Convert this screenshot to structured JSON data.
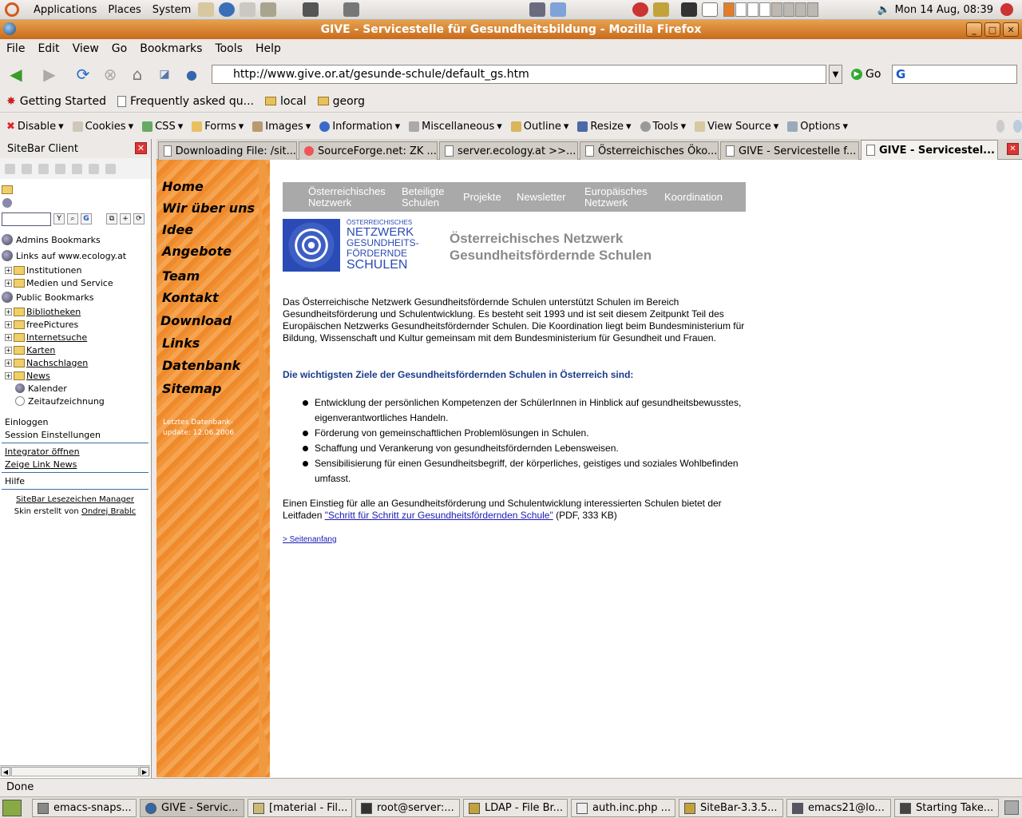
{
  "panel": {
    "menus": [
      "Applications",
      "Places",
      "System"
    ],
    "clock": "Mon 14 Aug, 08:39"
  },
  "window": {
    "title": "GIVE - Servicestelle für Gesundheitsbildung - Mozilla Firefox",
    "menu": [
      "File",
      "Edit",
      "View",
      "Go",
      "Bookmarks",
      "Tools",
      "Help"
    ]
  },
  "nav": {
    "url": "http://www.give.or.at/gesunde-schule/default_gs.htm",
    "go_label": "Go"
  },
  "bookmarks_bar": [
    "Getting Started",
    "Frequently asked qu...",
    "local",
    "georg"
  ],
  "devtoolbar": [
    "Disable",
    "Cookies",
    "CSS",
    "Forms",
    "Images",
    "Information",
    "Miscellaneous",
    "Outline",
    "Resize",
    "Tools",
    "View Source",
    "Options"
  ],
  "sidebar": {
    "title": "SiteBar Client",
    "tree": {
      "admins": "Admins Bookmarks",
      "links_root": "Links auf www.ecology.at",
      "links_children": [
        "Institutionen",
        "Medien und Service"
      ],
      "public_root": "Public Bookmarks",
      "public_children": [
        "Bibliotheken",
        "freePictures",
        "Internetsuche",
        "Karten",
        "Nachschlagen",
        "News"
      ],
      "kalender": "Kalender",
      "zeit": "Zeitaufzeichnung"
    },
    "links": {
      "login": "Einloggen",
      "session": "Session Einstellungen",
      "integrator": "Integrator öffnen",
      "link_news": "Zeige Link News",
      "help": "Hilfe"
    },
    "credit": {
      "manager": "SiteBar Lesezeichen Manager",
      "skin_prefix": "Skin erstellt von",
      "author": "Ondrej Brablc"
    }
  },
  "tabs": [
    {
      "label": "Downloading File: /sit..."
    },
    {
      "label": "SourceForge.net: ZK ..."
    },
    {
      "label": "server.ecology.at >>..."
    },
    {
      "label": "Österreichisches Öko..."
    },
    {
      "label": "GIVE - Servicestelle f..."
    },
    {
      "label": "GIVE - Servicestel..."
    }
  ],
  "page": {
    "leftnav": [
      "Home",
      "Wir über uns",
      "Idee",
      "Angebote",
      "Team",
      "Kontakt",
      "Download",
      "Links",
      "Datenbank",
      "Sitemap"
    ],
    "update_line1": "Letztes Datenbank-",
    "update_line2": "update: 12.06.2006",
    "topnav": [
      {
        "l1": "Österreichisches",
        "l2": "Netzwerk"
      },
      {
        "l1": "Beteiligte",
        "l2": "Schulen"
      },
      {
        "l1": "Projekte",
        "l2": ""
      },
      {
        "l1": "Newsletter",
        "l2": ""
      },
      {
        "l1": "Europäisches",
        "l2": "Netzwerk"
      },
      {
        "l1": "Koordination",
        "l2": ""
      }
    ],
    "logo": {
      "line1": "ÖSTERREICHISCHES",
      "line2": "NETZWERK",
      "line3": "GESUNDHEITS-",
      "line4": "FÖRDERNDE",
      "line5": "SCHULEN"
    },
    "heading1": "Österreichisches Netzwerk",
    "heading2": "Gesundheitsfördernde Schulen",
    "intro": "Das Österreichische Netzwerk Gesundheitsfördernde Schulen unterstützt Schulen im Bereich Gesundheitsförderung und Schulentwicklung. Es besteht seit 1993 und ist seit diesem Zeitpunkt Teil des Europäischen Netzwerks Gesundheitsfördernder Schulen. Die Koordination liegt beim Bundesministerium für Bildung, Wissenschaft und Kultur gemeinsam mit dem Bundesministerium für Gesundheit und Frauen.",
    "subheading": "Die wichtigsten Ziele der Gesundheitsfördernden Schulen in Österreich sind:",
    "bullets": [
      "Entwicklung der persönlichen Kompetenzen der SchülerInnen in Hinblick auf gesundheitsbewusstes, eigenverantwortliches Handeln.",
      "Förderung von gemeinschaftlichen Problemlösungen in Schulen.",
      "Schaffung und Verankerung von gesundheitsfördernden Lebensweisen.",
      "Sensibilisierung für einen Gesundheitsbegriff, der körperliches, geistiges und soziales Wohlbefinden umfasst."
    ],
    "outro_prefix": "Einen Einstieg für alle an Gesundheitsförderung und Schulentwicklung interessierten Schulen bietet der Leitfaden",
    "outro_link": "\"Schritt für Schritt zur Gesundheitsfördernden Schule\"",
    "outro_suffix": "(PDF, 333 KB)",
    "top_link": "> Seitenanfang"
  },
  "status": "Done",
  "taskbar": [
    "emacs-snaps...",
    "GIVE - Servic...",
    "[material - Fil...",
    "root@server:...",
    "LDAP - File Br...",
    "auth.inc.php ...",
    "SiteBar-3.3.5...",
    "emacs21@lo...",
    "Starting Take..."
  ],
  "colors": {
    "titlebar": "#d27a2a",
    "page_nav_orange": "#f29437",
    "link_blue": "#1a1ab4",
    "heading_gray": "#8a8a8a",
    "subhead_blue": "#1a3a8c"
  }
}
